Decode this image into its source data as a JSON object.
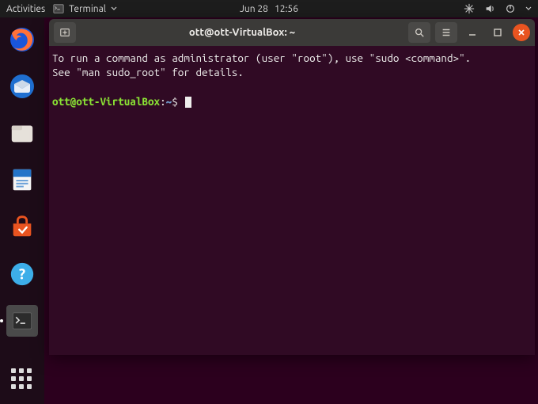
{
  "topbar": {
    "activities": "Activities",
    "app_name": "Terminal",
    "date": "Jun 28",
    "time": "12:56"
  },
  "dock": {
    "items": [
      {
        "name": "firefox"
      },
      {
        "name": "thunderbird"
      },
      {
        "name": "files"
      },
      {
        "name": "libreoffice-writer"
      },
      {
        "name": "ubuntu-software"
      },
      {
        "name": "help"
      },
      {
        "name": "terminal"
      }
    ]
  },
  "terminal": {
    "title": "ott@ott-VirtualBox: ~",
    "motd_line1": "To run a command as administrator (user \"root\"), use \"sudo <command>\".",
    "motd_line2": "See \"man sudo_root\" for details.",
    "prompt_userhost": "ott@ott-VirtualBox",
    "prompt_sep": ":",
    "prompt_path": "~",
    "prompt_symbol": "$"
  }
}
